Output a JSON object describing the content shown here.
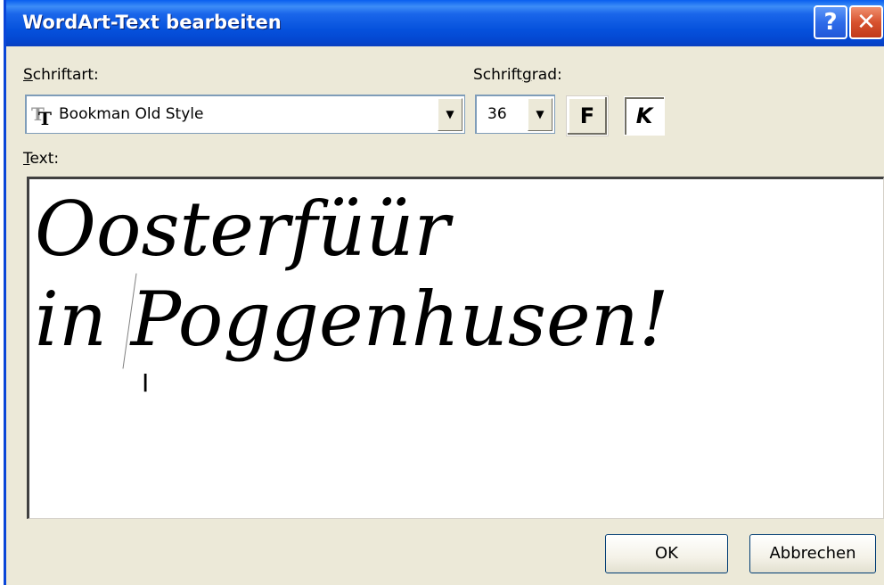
{
  "window": {
    "title": "WordArt-Text bearbeiten"
  },
  "titlebar_buttons": {
    "help": "?",
    "close": "✕"
  },
  "font": {
    "label_underlined": "S",
    "label_rest": "chriftart:",
    "value": "Bookman Old Style",
    "font_type_icon": "truetype-font-icon"
  },
  "size": {
    "label_pre": "Schrift",
    "label_underlined": "g",
    "label_post": "rad:",
    "value": "36"
  },
  "format": {
    "bold_label": "F",
    "italic_label": "K",
    "italic_active": true
  },
  "text": {
    "label_underlined": "T",
    "label_rest": "ext:",
    "line1": "Oosterfüür",
    "line2": "in Poggenhusen!"
  },
  "buttons": {
    "ok": "OK",
    "cancel": "Abbrechen"
  },
  "colors": {
    "titlebar_blue": "#0551DC",
    "dialog_face": "#ECE9D8",
    "close_red": "#D7522F"
  }
}
